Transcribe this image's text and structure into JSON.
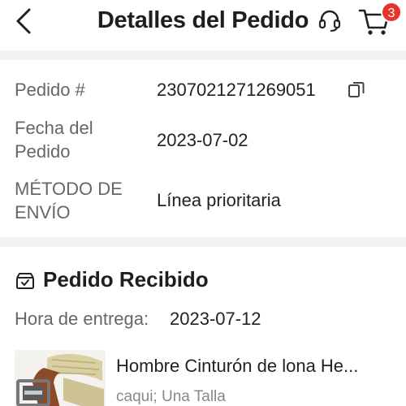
{
  "header": {
    "title": "Detalles del Pedido",
    "cart_count": "3",
    "icons": {
      "back": "chevron-left-icon",
      "support": "headset-icon",
      "cart": "cart-icon"
    }
  },
  "order": {
    "number_label": "Pedido #",
    "number_value": "2307021271269051",
    "date_label_line1": "Fecha del",
    "date_label_line2": "Pedido",
    "date_value": "2023-07-02",
    "shipping_label_line1": "MÉTODO DE",
    "shipping_label_line2": "ENVÍO",
    "shipping_value": "Línea prioritaria"
  },
  "status": {
    "title": "Pedido Recibido",
    "delivery_label": "Hora de entrega:",
    "delivery_value": "2023-07-12"
  },
  "product": {
    "name": "Hombre Cinturón de lona He...",
    "variant": "caqui; Una Talla"
  },
  "colors": {
    "accent": "#e8322b",
    "background": "#f2f2f2"
  }
}
